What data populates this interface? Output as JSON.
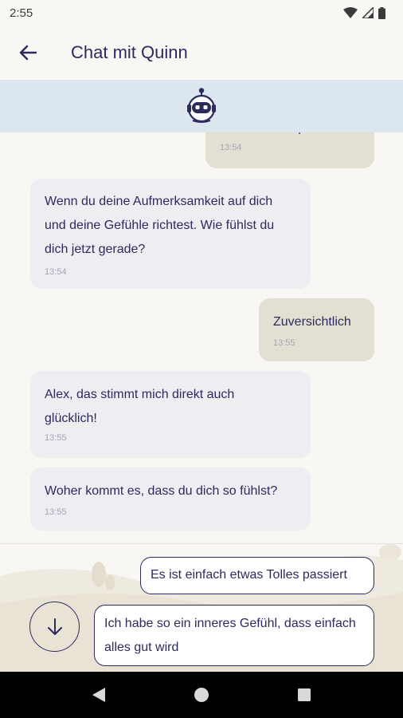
{
  "status_bar": {
    "time": "2:55"
  },
  "app_bar": {
    "title": "Chat mit Quinn"
  },
  "messages": [
    {
      "sender": "user",
      "text": "über Gefühle sprechen",
      "time": "13:54"
    },
    {
      "sender": "bot",
      "text": "Wenn du deine Aufmerksamkeit auf dich und deine Gefühle richtest. Wie fühlst du dich jetzt gerade?",
      "time": "13:54"
    },
    {
      "sender": "user",
      "text": "Zuversichtlich",
      "time": "13:55"
    },
    {
      "sender": "bot",
      "text": "Alex, das stimmt mich direkt auch glücklich!",
      "time": "13:55"
    },
    {
      "sender": "bot",
      "text": "Woher kommt es, dass du dich so fühlst?",
      "time": "13:55"
    }
  ],
  "quick_replies": [
    "Es ist einfach etwas Tolles passiert",
    "Ich habe so ein inneres Gefühl, dass einfach alles gut wird"
  ],
  "colors": {
    "primary": "#2d2a5e",
    "bot_bubble": "#eeedf2",
    "user_bubble": "#e3dfd2",
    "header_band": "#dce6ee",
    "background": "#f9f7f4"
  }
}
